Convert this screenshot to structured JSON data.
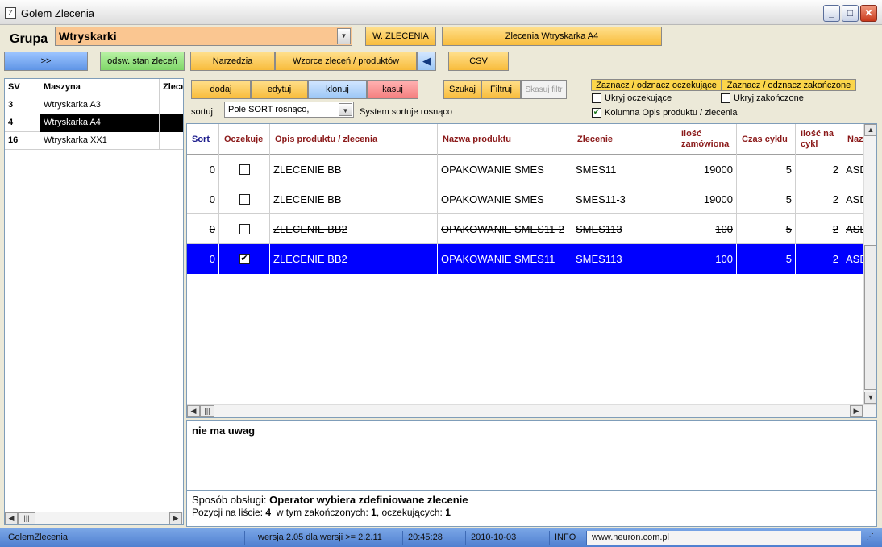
{
  "window": {
    "title": "Golem Zlecenia",
    "minimize": "_",
    "maximize": "□",
    "close": "✕",
    "app_icon": "Z"
  },
  "toolbar": {
    "grupa_label": "Grupa",
    "grupa_value": "Wtryskarki",
    "w_zlecenia": "W. ZLECENIA",
    "zlecenia_machine": "Zlecenia Wtryskarka A4",
    "expand": ">>",
    "refresh": "odsw. stan zleceń",
    "narzedzia": "Narzedzia",
    "wzorce": "Wzorce zleceń / produktów",
    "collapse_arrow": "◀",
    "csv": "CSV"
  },
  "machines": {
    "headers": [
      "SV",
      "Maszyna",
      "Zlece"
    ],
    "rows": [
      {
        "sv": "3",
        "name": "Wtryskarka A3",
        "zlec": ""
      },
      {
        "sv": "4",
        "name": "Wtryskarka A4",
        "zlec": ""
      },
      {
        "sv": "16",
        "name": "Wtryskarka XX1",
        "zlec": ""
      }
    ],
    "selected_index": 1
  },
  "actions": {
    "dodaj": "dodaj",
    "edytuj": "edytuj",
    "klonuj": "klonuj",
    "kasuj": "kasuj",
    "szukaj": "Szukaj",
    "filtruj": "Filtruj",
    "skasuj_filtr": "Skasuj filtr",
    "toggle_waiting": "Zaznacz / odznacz oczekujące",
    "toggle_done": "Zaznacz / odznacz zakończone"
  },
  "sort": {
    "label": "sortuj",
    "value": "Pole SORT rosnąco,",
    "system_note": "System sortuje rosnąco"
  },
  "options": {
    "hide_waiting": {
      "label": "Ukryj oczekujące",
      "checked": false
    },
    "hide_done": {
      "label": "Ukryj  zakończone",
      "checked": false
    },
    "column_desc": {
      "label": "Kolumna Opis produktu / zlecenia",
      "checked": true
    }
  },
  "grid": {
    "headers": [
      "Sort",
      "Oczekuje",
      "Opis produktu / zlecenia",
      "Nazwa produktu",
      "Zlecenie",
      "Ilość zamówiona",
      "Czas cyklu",
      "Ilość na cykl",
      "Naz"
    ],
    "rows": [
      {
        "sort": "0",
        "waiting": false,
        "desc": "ZLECENIE BB",
        "product": "OPAKOWANIE SMES",
        "order": "SMES11",
        "qty": "19000",
        "cycle": "5",
        "per_cycle": "2",
        "extra": "ASD",
        "state": "normal"
      },
      {
        "sort": "0",
        "waiting": false,
        "desc": "ZLECENIE BB",
        "product": "OPAKOWANIE SMES",
        "order": "SMES11-3",
        "qty": "19000",
        "cycle": "5",
        "per_cycle": "2",
        "extra": "ASD",
        "state": "normal"
      },
      {
        "sort": "0",
        "waiting": false,
        "desc": "ZLECENIE BB2",
        "product": "OPAKOWANIE SMES11-2",
        "order": "SMES113",
        "qty": "100",
        "cycle": "5",
        "per_cycle": "2",
        "extra": "ASD",
        "state": "done"
      },
      {
        "sort": "0",
        "waiting": true,
        "desc": "ZLECENIE BB2",
        "product": "OPAKOWANIE SMES11",
        "order": "SMES113",
        "qty": "100",
        "cycle": "5",
        "per_cycle": "2",
        "extra": "ASD",
        "state": "selected"
      }
    ]
  },
  "notes": {
    "text": "nie ma uwag"
  },
  "info": {
    "mode_label": "Sposób obsługi:",
    "mode_value": "Operator wybiera zdefiniowane zlecenie",
    "count_label": "Pozycji na liście:",
    "count_value": "4",
    "done_label": "w tym zakończonych:",
    "done_value": "1",
    "waiting_label": ", oczekujących:",
    "waiting_value": "1"
  },
  "status": {
    "app": "GolemZlecenia",
    "version": "wersja 2.05 dla wersji >= 2.2.11",
    "time": "20:45:28",
    "date": "2010-10-03",
    "info": "INFO",
    "url": "www.neuron.com.pl"
  },
  "colors": {
    "selection": "#0000ff",
    "combo": "#fac691",
    "header_text": "#8b1a1a",
    "status_bar": "#5a88d8"
  }
}
